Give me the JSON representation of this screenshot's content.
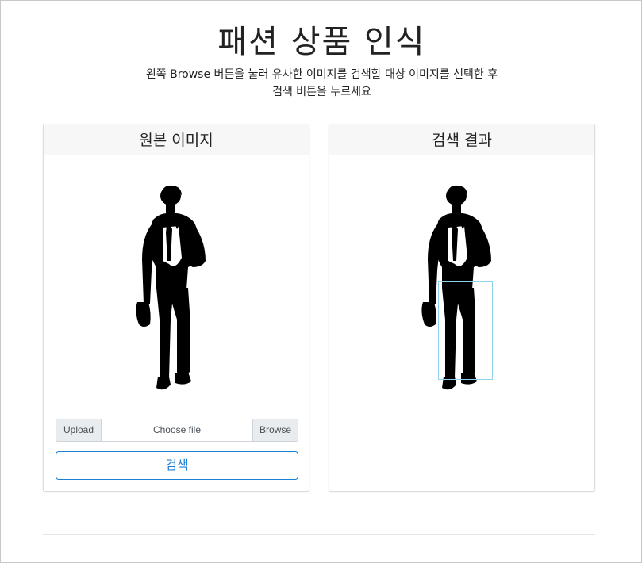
{
  "page": {
    "title": "패션 상품 인식",
    "subtitle_line1": "왼쪽 Browse 버튼을 눌러 유사한 이미지를 검색할 대상 이미지를 선택한 후",
    "subtitle_line2": "검색 버튼을 누르세요"
  },
  "left_card": {
    "header": "원본 이미지",
    "image_icon": "man-silhouette-icon",
    "upload": {
      "prefix_label": "Upload",
      "file_placeholder": "Choose file",
      "browse_label": "Browse"
    },
    "search_button_label": "검색"
  },
  "right_card": {
    "header": "검색 결과",
    "image_icon": "man-silhouette-icon",
    "detection_box_color": "#8fd2ea"
  },
  "colors": {
    "accent": "#1d7fd4",
    "card_header_bg": "#f7f7f7"
  }
}
